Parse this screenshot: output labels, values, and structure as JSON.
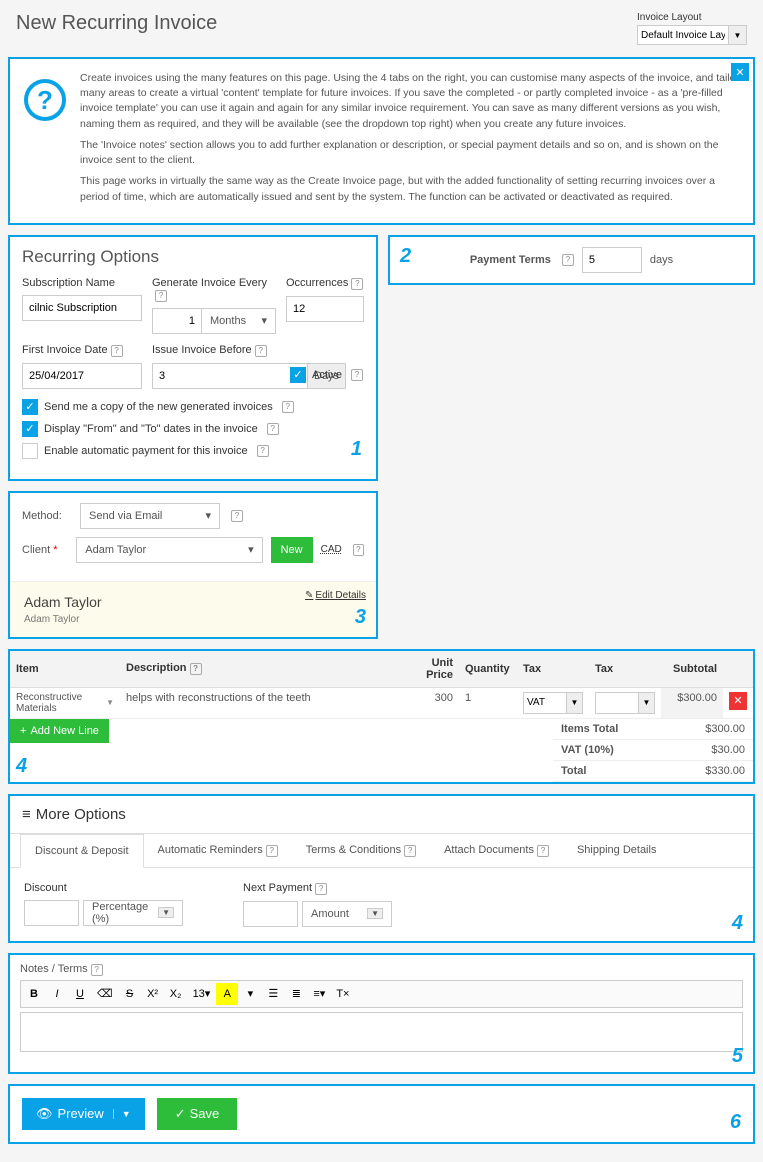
{
  "header": {
    "title": "New Recurring Invoice",
    "layout_label": "Invoice Layout",
    "layout_value": "Default Invoice Layout"
  },
  "info": {
    "p1": "Create invoices using the many features on this page. Using the 4 tabs on the right, you can customise many aspects of the invoice, and tailor many areas to create a virtual 'content' template for future invoices. If you save the completed - or partly completed invoice - as a 'pre-filled invoice template' you can use it again and again for any similar invoice requirement. You can save as many different versions as you wish, naming them as required, and they will be available (see the dropdown top right) when you create any future invoices.",
    "p2": "The 'Invoice notes' section allows you to add further explanation or description, or special payment details and so on, and is shown on the invoice sent to the client.",
    "p3": "This page works in virtually the same way as the Create Invoice page, but with the added functionality of setting recurring invoices over a period of time, which are automatically issued and sent by the system. The function can be activated or deactivated as required."
  },
  "recurring": {
    "title": "Recurring Options",
    "sub_name_label": "Subscription Name",
    "sub_name_value": "cilnic Subscription",
    "gen_label": "Generate Invoice Every",
    "gen_value": "1",
    "gen_unit": "Months",
    "occ_label": "Occurrences",
    "occ_value": "12",
    "first_date_label": "First Invoice Date",
    "first_date_value": "25/04/2017",
    "issue_before_label": "Issue Invoice Before",
    "issue_before_value": "3",
    "issue_before_unit": "Days",
    "active_label": "Active",
    "chk1": "Send me a copy of the new generated invoices",
    "chk2": "Display \"From\" and \"To\" dates in the invoice",
    "chk3": "Enable automatic payment for this invoice"
  },
  "payment": {
    "label": "Payment Terms",
    "value": "5",
    "unit": "days"
  },
  "method": {
    "method_label": "Method:",
    "method_value": "Send via Email",
    "client_label": "Client",
    "client_value": "Adam Taylor",
    "new_btn": "New",
    "currency": "CAD",
    "edit": "Edit Details",
    "client_name": "Adam Taylor",
    "client_sub": "Adam Taylor"
  },
  "items": {
    "cols": {
      "item": "Item",
      "desc": "Description",
      "price": "Unit Price",
      "qty": "Quantity",
      "tax": "Tax",
      "tax2": "Tax",
      "subtotal": "Subtotal"
    },
    "row": {
      "item": "Reconstructive Materials",
      "desc": "helps with reconstructions of the teeth",
      "price": "300",
      "qty": "1",
      "tax": "VAT",
      "tax2": "",
      "subtotal": "$300.00"
    },
    "add": "Add New Line",
    "items_total_label": "Items Total",
    "items_total": "$300.00",
    "vat_label": "VAT (10%)",
    "vat": "$30.00",
    "total_label": "Total",
    "total": "$330.00"
  },
  "more": {
    "title": "More Options",
    "tabs": [
      "Discount & Deposit",
      "Automatic Reminders",
      "Terms & Conditions",
      "Attach Documents",
      "Shipping Details"
    ],
    "discount_label": "Discount",
    "discount_type": "Percentage (%)",
    "next_label": "Next Payment",
    "next_type": "Amount"
  },
  "notes": {
    "label": "Notes / Terms"
  },
  "actions": {
    "preview": "Preview",
    "save": "Save"
  },
  "callouts": {
    "c1": "1",
    "c2": "2",
    "c3": "3",
    "c4a": "4",
    "c4b": "4",
    "c5": "5",
    "c6": "6"
  }
}
